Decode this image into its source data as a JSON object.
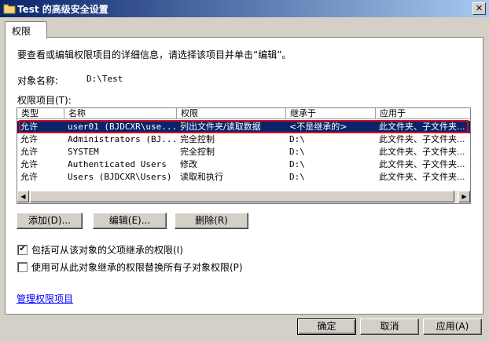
{
  "window": {
    "title": "Test 的高级安全设置",
    "close_label": "✕"
  },
  "tabs": [
    {
      "label": "权限"
    }
  ],
  "intro_text": "要查看或编辑权限项目的详细信息，请选择该项目并单击“编辑”。",
  "object_name": {
    "label": "对象名称:",
    "value": "D:\\Test"
  },
  "entries_label": "权限项目(T):",
  "columns": [
    "类型",
    "名称",
    "权限",
    "继承于",
    "应用于"
  ],
  "rows": [
    {
      "type": "允许",
      "name": "user01 (BJDCXR\\use...",
      "permission": "列出文件夹/读取数据",
      "inherited_from": "<不是继承的>",
      "applies_to": "此文件夹、子文件夹..."
    },
    {
      "type": "允许",
      "name": "Administrators (BJ...",
      "permission": "完全控制",
      "inherited_from": "D:\\",
      "applies_to": "此文件夹、子文件夹..."
    },
    {
      "type": "允许",
      "name": "SYSTEM",
      "permission": "完全控制",
      "inherited_from": "D:\\",
      "applies_to": "此文件夹、子文件夹..."
    },
    {
      "type": "允许",
      "name": "Authenticated Users",
      "permission": "修改",
      "inherited_from": "D:\\",
      "applies_to": "此文件夹、子文件夹..."
    },
    {
      "type": "允许",
      "name": "Users (BJDCXR\\Users)",
      "permission": "读取和执行",
      "inherited_from": "D:\\",
      "applies_to": "此文件夹、子文件夹..."
    }
  ],
  "buttons": {
    "add": "添加(D)...",
    "edit": "编辑(E)...",
    "remove": "删除(R)",
    "ok": "确定",
    "cancel": "取消",
    "apply": "应用(A)"
  },
  "checkboxes": [
    {
      "label": "包括可从该对象的父项继承的权限(I)",
      "checked": true
    },
    {
      "label": "使用可从此对象继承的权限替换所有子对象权限(P)",
      "checked": false
    }
  ],
  "manage_link": "管理权限项目",
  "colors": {
    "title_start": "#0a246a",
    "selection": "#0a246a",
    "highlight_outline": "#e0001b",
    "link": "#0000ff"
  }
}
